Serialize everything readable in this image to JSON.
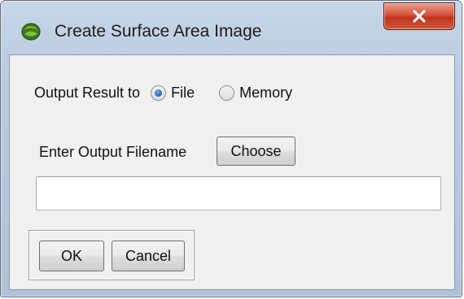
{
  "window": {
    "title": "Create Surface Area Image",
    "close_symbol": "✕"
  },
  "output": {
    "label": "Output Result to",
    "options": [
      {
        "label": "File",
        "checked": true
      },
      {
        "label": "Memory",
        "checked": false
      }
    ]
  },
  "filename": {
    "label": "Enter Output Filename",
    "choose_label": "Choose",
    "value": "",
    "placeholder": ""
  },
  "actions": {
    "ok_label": "OK",
    "cancel_label": "Cancel"
  },
  "icons": {
    "app": "app-icon",
    "close": "close-icon"
  },
  "colors": {
    "selected_radio": "#1d5fb4",
    "close_button": "#c1331c",
    "title_bar": "#b9cbe0"
  }
}
